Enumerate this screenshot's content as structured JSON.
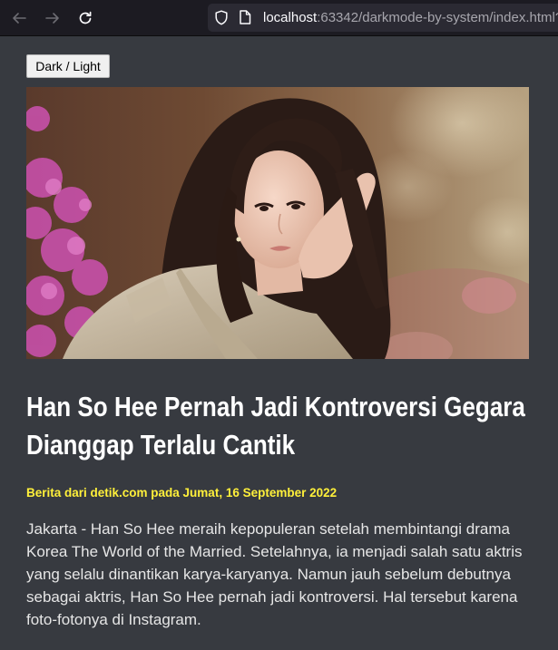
{
  "browser": {
    "url_host": "localhost",
    "url_rest": ":63342/darkmode-by-system/index.html?_",
    "icons": {
      "back": "arrow-left-icon",
      "forward": "arrow-right-icon",
      "reload": "reload-icon",
      "shield": "shield-icon",
      "page": "page-icon"
    }
  },
  "page": {
    "toggle_label": "Dark / Light",
    "image_alt": "Han So Hee portrait",
    "headline": "Han So Hee Pernah Jadi Kontroversi Gegara Dianggap Terlalu Cantik",
    "byline": "Berita dari detik.com pada Jumat, 16 September 2022",
    "body": "Jakarta - Han So Hee meraih kepopuleran setelah membintangi drama Korea The World of the Married. Setelahnya, ia menjadi salah satu aktris yang selalu dinantikan karya-karyanya. Namun jauh sebelum debutnya sebagai aktris, Han So Hee pernah jadi kontroversi. Hal tersebut karena foto-fotonya di Instagram."
  },
  "colors": {
    "page_background": "#373a40",
    "byline": "#fff03a",
    "headline": "#ffffff",
    "toolbar": "#1c1b22"
  }
}
